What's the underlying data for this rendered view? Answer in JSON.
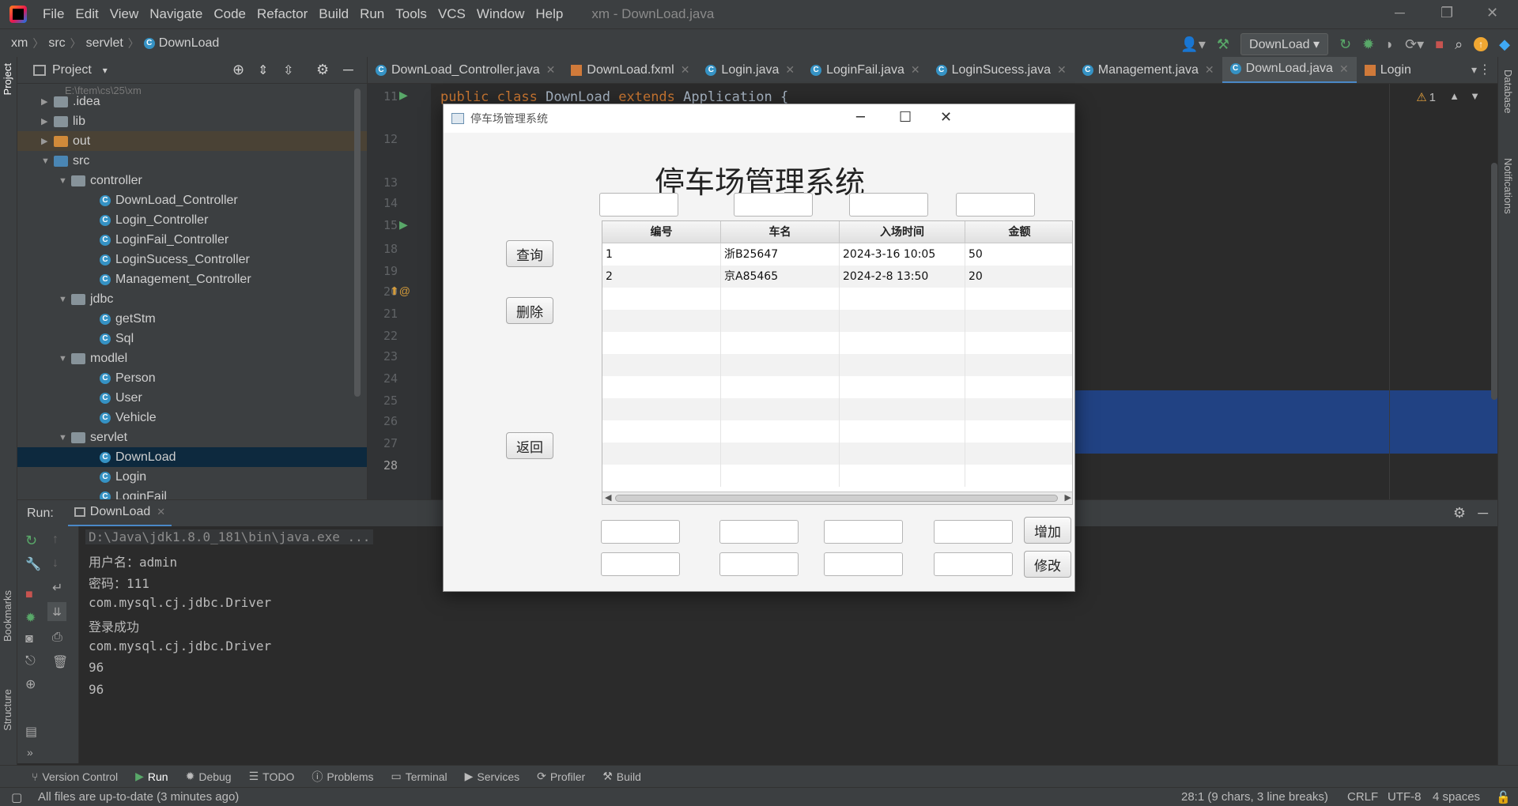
{
  "ide": {
    "window_title": "xm - DownLoad.java",
    "menu": [
      "File",
      "Edit",
      "View",
      "Navigate",
      "Code",
      "Refactor",
      "Build",
      "Run",
      "Tools",
      "VCS",
      "Window",
      "Help"
    ],
    "breadcrumb": [
      "xm",
      "src",
      "servlet",
      "DownLoad"
    ],
    "run_config": "DownLoad",
    "accent": "#4a88c7"
  },
  "project": {
    "header": "Project",
    "root_path_hint": "E:\\ftem\\cs\\25\\xm",
    "tree": [
      {
        "label": ".idea",
        "kind": "folder"
      },
      {
        "label": "lib",
        "kind": "folder"
      },
      {
        "label": "out",
        "kind": "folder-out"
      },
      {
        "label": "src",
        "kind": "folder-src"
      },
      {
        "label": "controller",
        "kind": "package"
      },
      {
        "label": "DownLoad_Controller",
        "kind": "class"
      },
      {
        "label": "Login_Controller",
        "kind": "class"
      },
      {
        "label": "LoginFail_Controller",
        "kind": "class"
      },
      {
        "label": "LoginSucess_Controller",
        "kind": "class"
      },
      {
        "label": "Management_Controller",
        "kind": "class"
      },
      {
        "label": "jdbc",
        "kind": "package"
      },
      {
        "label": "getStm",
        "kind": "class"
      },
      {
        "label": "Sql",
        "kind": "class"
      },
      {
        "label": "modlel",
        "kind": "package"
      },
      {
        "label": "Person",
        "kind": "class"
      },
      {
        "label": "User",
        "kind": "class"
      },
      {
        "label": "Vehicle",
        "kind": "class"
      },
      {
        "label": "servlet",
        "kind": "package"
      },
      {
        "label": "DownLoad",
        "kind": "class"
      },
      {
        "label": "Login",
        "kind": "class"
      },
      {
        "label": "LoginFail",
        "kind": "class"
      }
    ]
  },
  "editor": {
    "tabs": [
      "DownLoad_Controller.java",
      "DownLoad.fxml",
      "Login.java",
      "LoginFail.java",
      "LoginSucess.java",
      "Management.java",
      "DownLoad.java",
      "Login"
    ],
    "line_numbers": [
      "11",
      "12",
      "13",
      "14",
      "15",
      "18",
      "19",
      "20",
      "21",
      "22",
      "23",
      "24",
      "25",
      "26",
      "27",
      "28"
    ],
    "code": {
      "kw1": "public",
      "kw2": "class",
      "name": "DownLoad",
      "kw3": "extends",
      "parent": "Application",
      "brace": "{"
    },
    "warnings": "1"
  },
  "run": {
    "label": "Run:",
    "tab": "DownLoad",
    "console": [
      "D:\\Java\\jdk1.8.0_181\\bin\\java.exe ...",
      "用户名：admin",
      "密码：111",
      "com.mysql.cj.jdbc.Driver",
      "登录成功",
      "com.mysql.cj.jdbc.Driver",
      "96",
      "96"
    ]
  },
  "tool_tabs": [
    "Version Control",
    "Run",
    "Debug",
    "TODO",
    "Problems",
    "Terminal",
    "Services",
    "Profiler",
    "Build"
  ],
  "side_tabs": {
    "left": [
      "Project",
      "Bookmarks",
      "Structure"
    ],
    "right": [
      "Database",
      "Notifications"
    ]
  },
  "status": {
    "message": "All files are up-to-date (3 minutes ago)",
    "position": "28:1 (9 chars, 3 line breaks)",
    "line_sep": "CRLF",
    "encoding": "UTF-8",
    "indent": "4 spaces"
  },
  "app": {
    "title": "停车场管理系统",
    "heading": "停车场管理系统",
    "buttons": {
      "query": "查询",
      "delete": "删除",
      "back": "返回",
      "add": "增加",
      "edit": "修改"
    },
    "columns": [
      "编号",
      "车名",
      "入场时间",
      "金额"
    ],
    "rows": [
      [
        "1",
        "浙B25647",
        "2024-3-16 10:05",
        "50"
      ],
      [
        "2",
        "京A85465",
        "2024-2-8 13:50",
        "20"
      ]
    ]
  }
}
